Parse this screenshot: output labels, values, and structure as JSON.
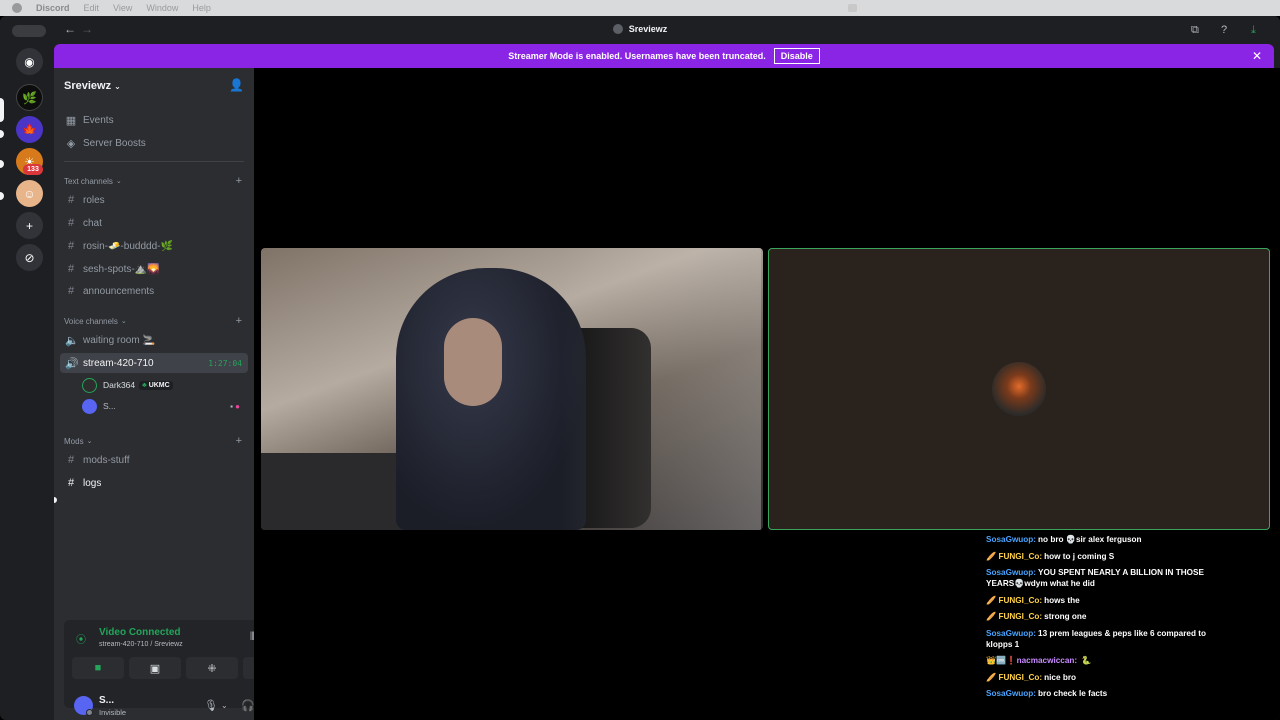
{
  "menubar": {
    "app": "Discord",
    "items": [
      "Edit",
      "View",
      "Window",
      "Help"
    ]
  },
  "window": {
    "title": "Sreviewz"
  },
  "rail": {
    "badge": "133"
  },
  "banner": {
    "text": "Streamer Mode is enabled. Usernames have been truncated.",
    "button": "Disable"
  },
  "server": {
    "name": "Sreviewz"
  },
  "links": [
    {
      "label": "Events",
      "icon": "calendar-icon"
    },
    {
      "label": "Server Boosts",
      "icon": "boost-icon"
    }
  ],
  "categories": {
    "text": "Text channels",
    "voice": "Voice channels",
    "mods": "Mods"
  },
  "text_channels": [
    "roles",
    "chat",
    "rosin-🧈-budddd-🌿",
    "sesh-spots-⛰️🌄",
    "announcements"
  ],
  "voice_channels": [
    {
      "name": "waiting room 🚬"
    },
    {
      "name": "stream-420-710",
      "time": "1:27:04"
    }
  ],
  "voice_users": [
    {
      "name": "Dark364",
      "tag": "UKMC"
    },
    {
      "name": "S..."
    }
  ],
  "mod_channels": [
    "mods-stuff",
    "logs"
  ],
  "voice_panel": {
    "status": "Video Connected",
    "sub": "stream-420-710 / Sreviewz"
  },
  "user": {
    "name": "S...",
    "status": "Invisible"
  },
  "chat": [
    {
      "user": "SosaGwuop:",
      "color": "blue",
      "text": "no bro 💀sir alex ferguson"
    },
    {
      "user": "FUNGI_Co:",
      "color": "gold",
      "prefix": "🥖",
      "text": "how to j coming S"
    },
    {
      "user": "SosaGwuop:",
      "color": "blue",
      "text": "YOU SPENT NEARLY A BILLION IN THOSE YEARS💀wdym what he did"
    },
    {
      "user": "FUNGI_Co:",
      "color": "gold",
      "prefix": "🥖",
      "text": "hows the"
    },
    {
      "user": "FUNGI_Co:",
      "color": "gold",
      "prefix": "🥖",
      "text": "strong one"
    },
    {
      "user": "SosaGwuop:",
      "color": "blue",
      "text": "13 prem leagues & peps like 6 compared to klopps 1"
    },
    {
      "user": "nacmacwiccan:",
      "color": "purple",
      "prefix": "👑🆒❗",
      "text": "🐍"
    },
    {
      "user": "FUNGI_Co:",
      "color": "gold",
      "prefix": "🥖",
      "text": "nice bro"
    },
    {
      "user": "SosaGwuop:",
      "color": "blue",
      "text": "bro check le facts"
    }
  ]
}
